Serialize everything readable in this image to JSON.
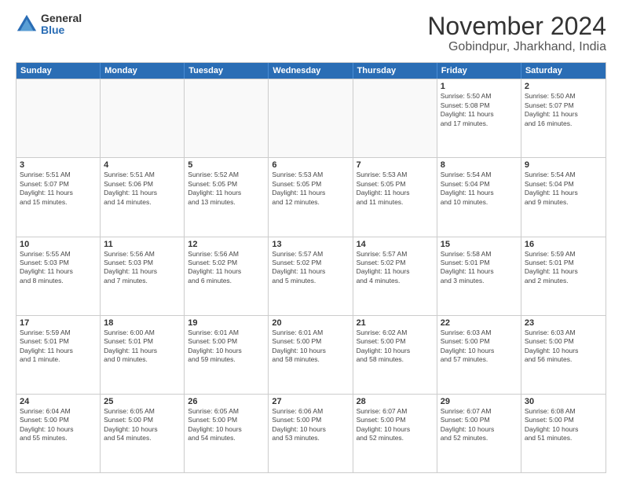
{
  "logo": {
    "general": "General",
    "blue": "Blue"
  },
  "header": {
    "month": "November 2024",
    "location": "Gobindpur, Jharkhand, India"
  },
  "days_of_week": [
    "Sunday",
    "Monday",
    "Tuesday",
    "Wednesday",
    "Thursday",
    "Friday",
    "Saturday"
  ],
  "weeks": [
    [
      {
        "day": "",
        "empty": true
      },
      {
        "day": "",
        "empty": true
      },
      {
        "day": "",
        "empty": true
      },
      {
        "day": "",
        "empty": true
      },
      {
        "day": "",
        "empty": true
      },
      {
        "day": "1",
        "info": "Sunrise: 5:50 AM\nSunset: 5:08 PM\nDaylight: 11 hours\nand 17 minutes."
      },
      {
        "day": "2",
        "info": "Sunrise: 5:50 AM\nSunset: 5:07 PM\nDaylight: 11 hours\nand 16 minutes."
      }
    ],
    [
      {
        "day": "3",
        "info": "Sunrise: 5:51 AM\nSunset: 5:07 PM\nDaylight: 11 hours\nand 15 minutes."
      },
      {
        "day": "4",
        "info": "Sunrise: 5:51 AM\nSunset: 5:06 PM\nDaylight: 11 hours\nand 14 minutes."
      },
      {
        "day": "5",
        "info": "Sunrise: 5:52 AM\nSunset: 5:05 PM\nDaylight: 11 hours\nand 13 minutes."
      },
      {
        "day": "6",
        "info": "Sunrise: 5:53 AM\nSunset: 5:05 PM\nDaylight: 11 hours\nand 12 minutes."
      },
      {
        "day": "7",
        "info": "Sunrise: 5:53 AM\nSunset: 5:05 PM\nDaylight: 11 hours\nand 11 minutes."
      },
      {
        "day": "8",
        "info": "Sunrise: 5:54 AM\nSunset: 5:04 PM\nDaylight: 11 hours\nand 10 minutes."
      },
      {
        "day": "9",
        "info": "Sunrise: 5:54 AM\nSunset: 5:04 PM\nDaylight: 11 hours\nand 9 minutes."
      }
    ],
    [
      {
        "day": "10",
        "info": "Sunrise: 5:55 AM\nSunset: 5:03 PM\nDaylight: 11 hours\nand 8 minutes."
      },
      {
        "day": "11",
        "info": "Sunrise: 5:56 AM\nSunset: 5:03 PM\nDaylight: 11 hours\nand 7 minutes."
      },
      {
        "day": "12",
        "info": "Sunrise: 5:56 AM\nSunset: 5:02 PM\nDaylight: 11 hours\nand 6 minutes."
      },
      {
        "day": "13",
        "info": "Sunrise: 5:57 AM\nSunset: 5:02 PM\nDaylight: 11 hours\nand 5 minutes."
      },
      {
        "day": "14",
        "info": "Sunrise: 5:57 AM\nSunset: 5:02 PM\nDaylight: 11 hours\nand 4 minutes."
      },
      {
        "day": "15",
        "info": "Sunrise: 5:58 AM\nSunset: 5:01 PM\nDaylight: 11 hours\nand 3 minutes."
      },
      {
        "day": "16",
        "info": "Sunrise: 5:59 AM\nSunset: 5:01 PM\nDaylight: 11 hours\nand 2 minutes."
      }
    ],
    [
      {
        "day": "17",
        "info": "Sunrise: 5:59 AM\nSunset: 5:01 PM\nDaylight: 11 hours\nand 1 minute."
      },
      {
        "day": "18",
        "info": "Sunrise: 6:00 AM\nSunset: 5:01 PM\nDaylight: 11 hours\nand 0 minutes."
      },
      {
        "day": "19",
        "info": "Sunrise: 6:01 AM\nSunset: 5:00 PM\nDaylight: 10 hours\nand 59 minutes."
      },
      {
        "day": "20",
        "info": "Sunrise: 6:01 AM\nSunset: 5:00 PM\nDaylight: 10 hours\nand 58 minutes."
      },
      {
        "day": "21",
        "info": "Sunrise: 6:02 AM\nSunset: 5:00 PM\nDaylight: 10 hours\nand 58 minutes."
      },
      {
        "day": "22",
        "info": "Sunrise: 6:03 AM\nSunset: 5:00 PM\nDaylight: 10 hours\nand 57 minutes."
      },
      {
        "day": "23",
        "info": "Sunrise: 6:03 AM\nSunset: 5:00 PM\nDaylight: 10 hours\nand 56 minutes."
      }
    ],
    [
      {
        "day": "24",
        "info": "Sunrise: 6:04 AM\nSunset: 5:00 PM\nDaylight: 10 hours\nand 55 minutes."
      },
      {
        "day": "25",
        "info": "Sunrise: 6:05 AM\nSunset: 5:00 PM\nDaylight: 10 hours\nand 54 minutes."
      },
      {
        "day": "26",
        "info": "Sunrise: 6:05 AM\nSunset: 5:00 PM\nDaylight: 10 hours\nand 54 minutes."
      },
      {
        "day": "27",
        "info": "Sunrise: 6:06 AM\nSunset: 5:00 PM\nDaylight: 10 hours\nand 53 minutes."
      },
      {
        "day": "28",
        "info": "Sunrise: 6:07 AM\nSunset: 5:00 PM\nDaylight: 10 hours\nand 52 minutes."
      },
      {
        "day": "29",
        "info": "Sunrise: 6:07 AM\nSunset: 5:00 PM\nDaylight: 10 hours\nand 52 minutes."
      },
      {
        "day": "30",
        "info": "Sunrise: 6:08 AM\nSunset: 5:00 PM\nDaylight: 10 hours\nand 51 minutes."
      }
    ]
  ]
}
